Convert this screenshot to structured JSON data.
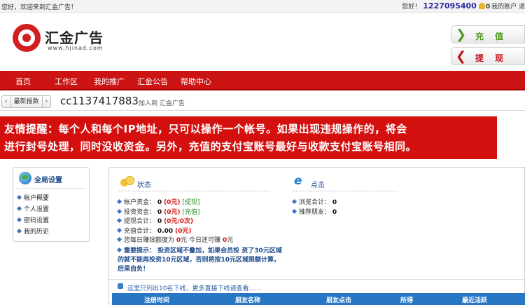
{
  "topbar": {
    "welcome": "您好，欢迎来到汇金广告！",
    "greeting": "您好！",
    "user_id": "1227095400",
    "balance": "0",
    "account_link": "我的账户",
    "logout_link": "退"
  },
  "brand": {
    "name": "汇金广告",
    "url": "www.hjinad.com",
    "color": "#d21e1e"
  },
  "side_buttons": {
    "recharge": "充值",
    "withdraw": "提现"
  },
  "nav": {
    "items": [
      "首页",
      "工作区",
      "我的推广",
      "汇金公告",
      "帮助中心"
    ]
  },
  "crumb": {
    "latest_label": "最新报数",
    "next": "›",
    "prev": "‹",
    "username": "cc1137417883",
    "join_text": "加入到 汇金广告"
  },
  "notice": {
    "line1": "友情提醒：每个人和每个IP地址，只可以操作一个帐号。如果出现违规操作的，将会",
    "line2": "进行封号处理，同时没收资金。另外，充值的支付宝账号最好与收款支付宝账号相同。"
  },
  "left_panel": {
    "title": "全局设置",
    "items": [
      "帐户概要",
      "个人设置",
      "密码设置",
      "我的历史"
    ]
  },
  "status": {
    "title": "状态",
    "account_funds_label": "帐户资金：",
    "account_funds_value": "0",
    "account_funds_unit": "(0元)",
    "withdraw_link": "[提现]",
    "invest_funds_label": "投资资金：",
    "invest_funds_value": "0",
    "invest_funds_unit": "(0元)",
    "recharge_link": "[充值]",
    "withdraw_total_label": "提现合计：",
    "withdraw_total_value": "0",
    "withdraw_total_unit": "(0元/0次)",
    "recharge_total_label": "充值合计：",
    "recharge_total_value": "0.00",
    "recharge_total_unit": "(0元)",
    "daily_earn_label": "您每日赚钱额度为",
    "daily_earn_value": "0",
    "daily_earn_unit": "元",
    "today_label": "今日还可赚",
    "today_value": "0",
    "today_unit": "元",
    "tip_label": "重要提示：",
    "tip_text": "投资区域不叠加，如果会员投 资了30元区域的就不能再投资10元区域，否则将按10元区域限额计算，后果自负！"
  },
  "clicks": {
    "title": "点击",
    "browse_label": "浏览合计：",
    "browse_value": "0",
    "refer_label": "推荐朋友：",
    "refer_value": "0"
  },
  "list": {
    "hint": "这里只列出10名下线，更多直接下线请查看......",
    "columns": [
      "注册时间",
      "朋友名称",
      "朋友点击",
      "所得",
      "最近活跃"
    ]
  }
}
